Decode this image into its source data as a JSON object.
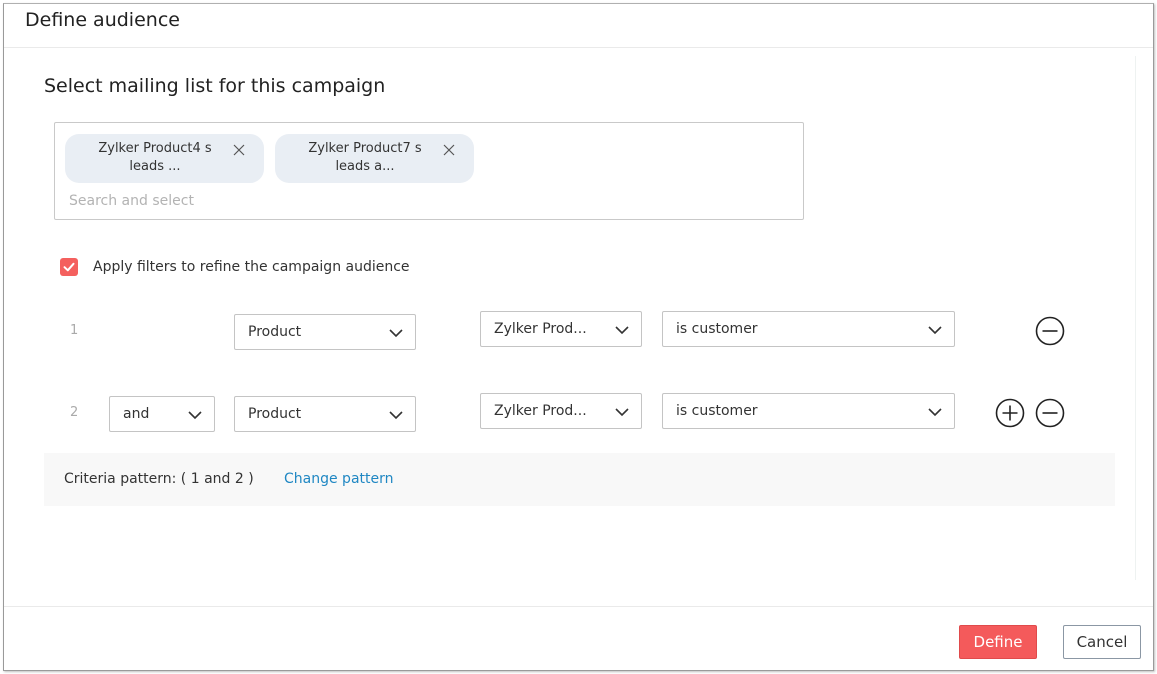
{
  "dialog": {
    "title": "Define audience"
  },
  "mailing_list": {
    "section_title": "Select mailing list for this campaign",
    "chips": [
      {
        "label": "Zylker Product4 s\nleads ...",
        "close_icon": "close-icon"
      },
      {
        "label": "Zylker Product7 s\nleads a...",
        "close_icon": "close-icon"
      }
    ],
    "search_placeholder": "Search and select",
    "search_value": ""
  },
  "filters": {
    "apply_checked": true,
    "apply_label": "Apply filters to refine the campaign audience",
    "checkbox_color": "#f4605e",
    "rows": [
      {
        "number": "1",
        "operator": null,
        "field": "Product",
        "value": "Zylker Prod...",
        "condition": "is customer",
        "actions": [
          "remove"
        ]
      },
      {
        "number": "2",
        "operator": "and",
        "field": "Product",
        "value": "Zylker Prod...",
        "condition": "is customer",
        "actions": [
          "add",
          "remove"
        ]
      }
    ]
  },
  "criteria": {
    "label": "Criteria pattern: ( 1 and 2 )",
    "change_link": "Change pattern",
    "link_color": "#1f87c3"
  },
  "footer": {
    "define_label": "Define",
    "cancel_label": "Cancel",
    "primary_color": "#f45a5b"
  }
}
